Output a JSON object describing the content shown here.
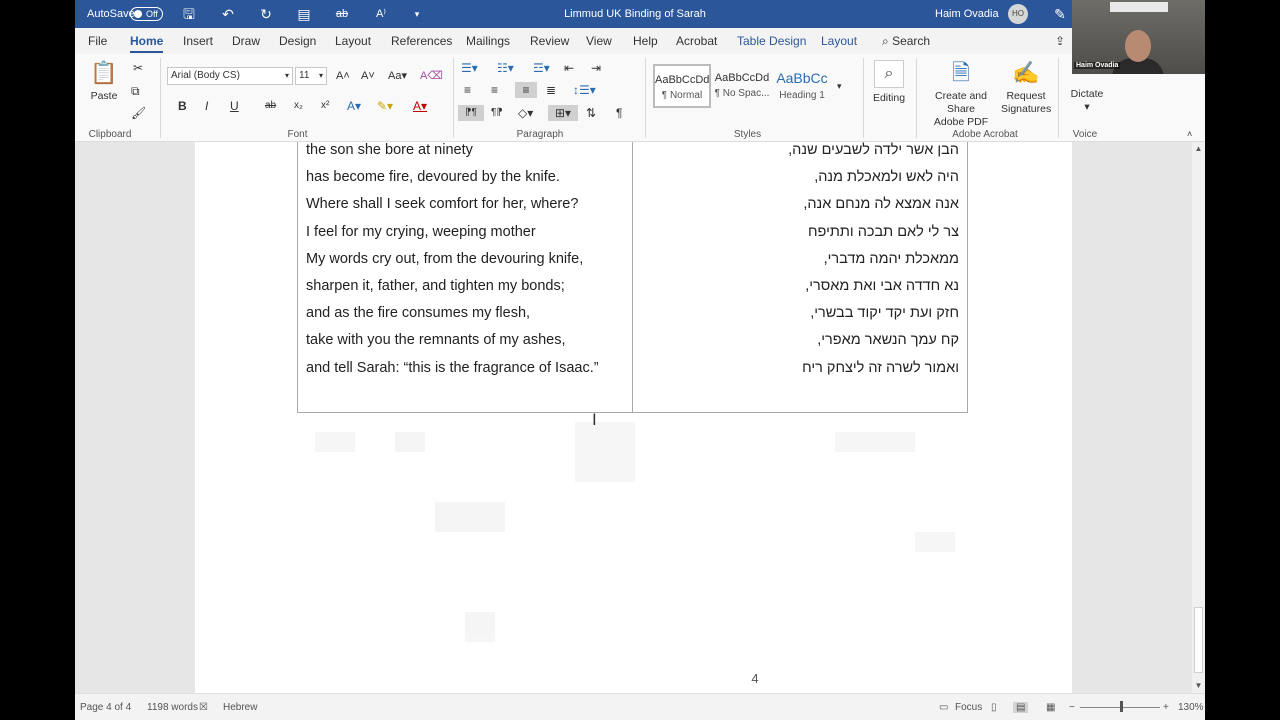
{
  "titlebar": {
    "autosave_label": "AutoSave",
    "autosave_state": "Off",
    "doc_title": "Limmud UK Binding of Sarah",
    "user_name": "Haim Ovadia",
    "user_initials": "HO"
  },
  "tabs": [
    "File",
    "Home",
    "Insert",
    "Draw",
    "Design",
    "Layout",
    "References",
    "Mailings",
    "Review",
    "View",
    "Help",
    "Acrobat",
    "Table Design",
    "Layout"
  ],
  "search_label": "Search",
  "ribbon": {
    "clipboard": {
      "paste": "Paste",
      "group": "Clipboard"
    },
    "font": {
      "name": "Arial (Body CS)",
      "size": "11",
      "group": "Font"
    },
    "paragraph": {
      "group": "Paragraph"
    },
    "styles": {
      "items": [
        {
          "sample": "AaBbCcDd",
          "name": "¶ Normal"
        },
        {
          "sample": "AaBbCcDd",
          "name": "¶ No Spac..."
        },
        {
          "sample": "AaBbCc",
          "name": "Heading 1"
        }
      ],
      "group": "Styles"
    },
    "editing": "Editing",
    "acrobat": {
      "create_line1": "Create and Share",
      "create_line2": "Adobe PDF",
      "request_line1": "Request",
      "request_line2": "Signatures",
      "group": "Adobe Acrobat"
    },
    "voice": {
      "dictate": "Dictate",
      "group": "Voice"
    }
  },
  "document": {
    "english_lines": [
      "the son she bore at ninety",
      "has become fire, devoured by the knife.",
      "Where shall I seek comfort for her, where?",
      "I feel for my crying, weeping mother",
      "My words cry out, from the devouring knife,",
      "sharpen it, father, and tighten my bonds;",
      "and as the fire consumes my flesh,",
      "take with you the remnants of my ashes,",
      "and tell Sarah: “this is the fragrance of Isaac.”"
    ],
    "hebrew_lines": [
      "הבן אשר ילדה לשבעים שנה,",
      "היה לאש ולמאכלת מנה,",
      "אנה אמצא לה מנחם אנה,",
      "צר לי לאם תבכה ותתיפח",
      "ממאכלת יהמה מדברי,",
      "נא חדדה אבי ואת מאסרי,",
      "חזק ועת יקד יקוד בבשרי,",
      "קח עמך הנשאר מאפרי,",
      "ואמור לשרה זה ליצחק ריח"
    ],
    "page_number": "4"
  },
  "statusbar": {
    "page": "Page 4 of 4",
    "words": "1198 words",
    "language": "Hebrew",
    "focus": "Focus",
    "zoom": "130%"
  },
  "webcam": {
    "name": "Haim Ovadia"
  }
}
